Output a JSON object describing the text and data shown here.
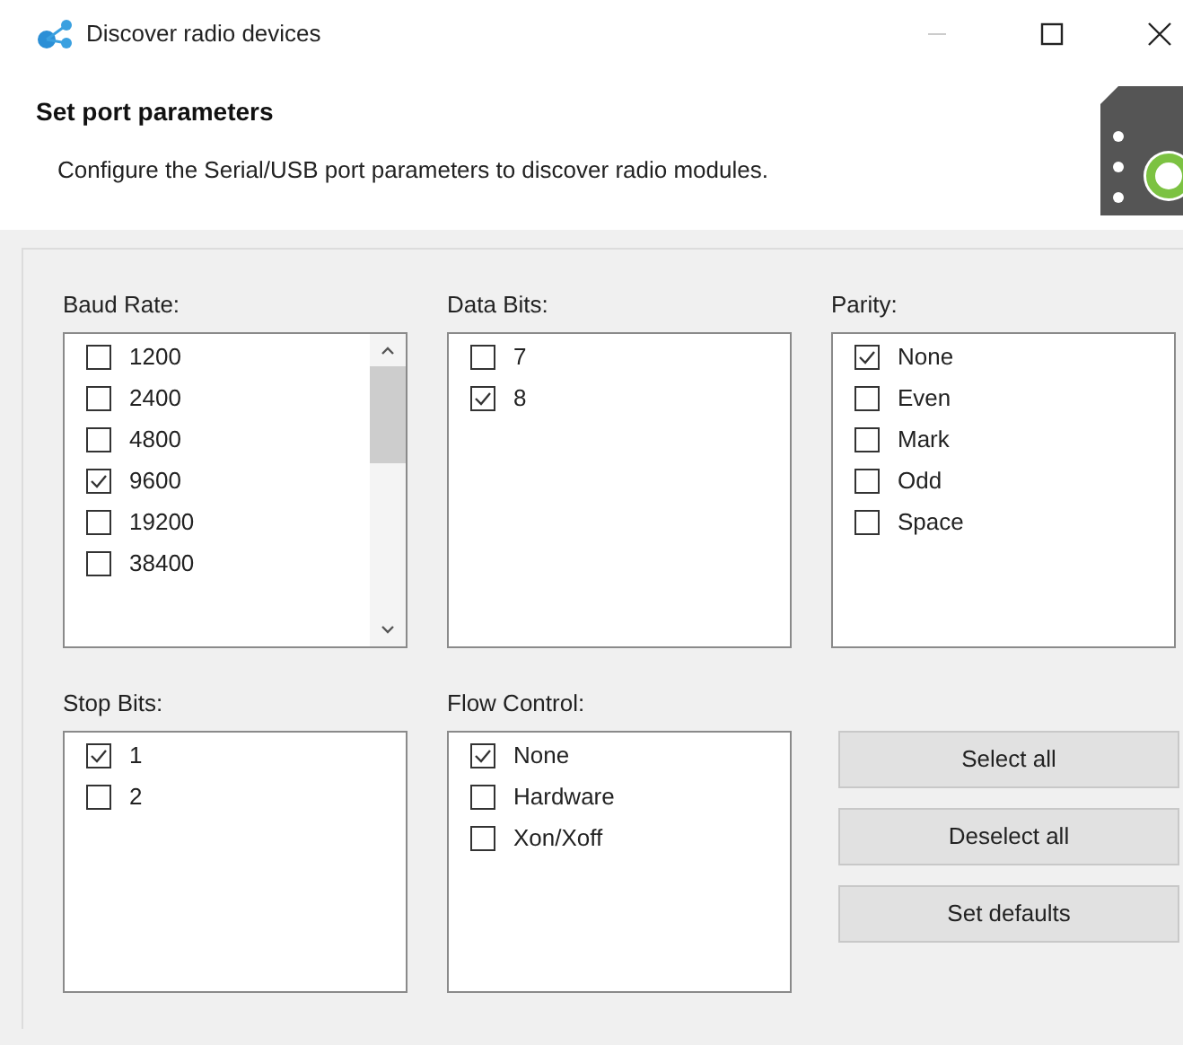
{
  "window": {
    "title": "Discover radio devices"
  },
  "header": {
    "title": "Set port parameters",
    "description": "Configure the Serial/USB port parameters to discover radio modules."
  },
  "groups": [
    {
      "label": "Baud Rate:",
      "scrollable": true,
      "items": [
        {
          "label": "1200",
          "checked": false
        },
        {
          "label": "2400",
          "checked": false
        },
        {
          "label": "4800",
          "checked": false
        },
        {
          "label": "9600",
          "checked": true
        },
        {
          "label": "19200",
          "checked": false
        },
        {
          "label": "38400",
          "checked": false
        }
      ]
    },
    {
      "label": "Data Bits:",
      "scrollable": false,
      "items": [
        {
          "label": "7",
          "checked": false
        },
        {
          "label": "8",
          "checked": true
        }
      ]
    },
    {
      "label": "Parity:",
      "scrollable": false,
      "items": [
        {
          "label": "None",
          "checked": true
        },
        {
          "label": "Even",
          "checked": false
        },
        {
          "label": "Mark",
          "checked": false
        },
        {
          "label": "Odd",
          "checked": false
        },
        {
          "label": "Space",
          "checked": false
        }
      ]
    },
    {
      "label": "Stop Bits:",
      "scrollable": false,
      "items": [
        {
          "label": "1",
          "checked": true
        },
        {
          "label": "2",
          "checked": false
        }
      ]
    },
    {
      "label": "Flow Control:",
      "scrollable": false,
      "items": [
        {
          "label": "None",
          "checked": true
        },
        {
          "label": "Hardware",
          "checked": false
        },
        {
          "label": "Xon/Xoff",
          "checked": false
        }
      ]
    }
  ],
  "buttons": [
    "Select all",
    "Deselect all",
    "Set defaults"
  ]
}
